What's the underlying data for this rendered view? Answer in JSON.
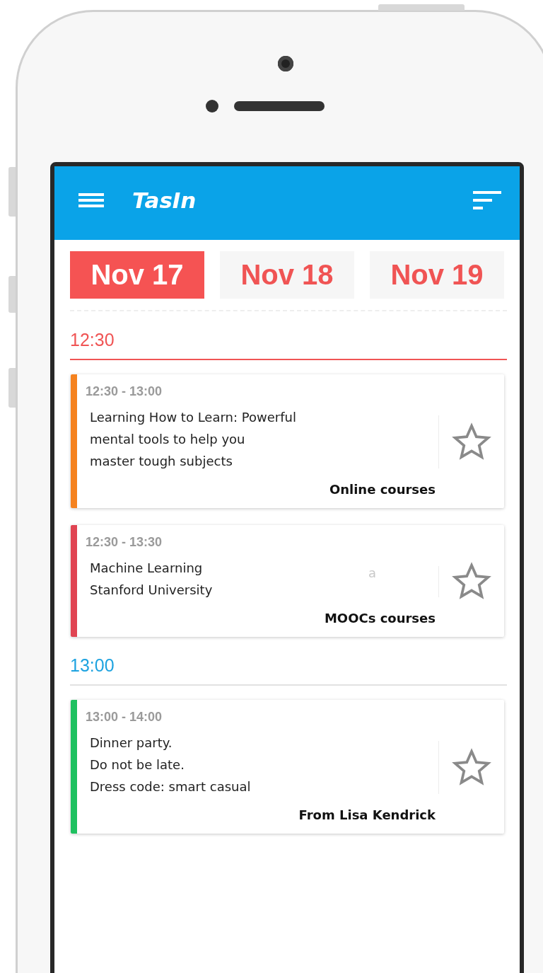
{
  "app_bar": {
    "title": "TasIn"
  },
  "date_tabs": [
    {
      "label": "Nov 17",
      "selected": true
    },
    {
      "label": "Nov 18",
      "selected": false
    },
    {
      "label": "Nov 19",
      "selected": false
    }
  ],
  "time_groups": [
    {
      "label": "12:30",
      "color": "#f05454",
      "current": true,
      "events": [
        {
          "time": "12:30 - 13:00",
          "lines": [
            "Learning How to Learn: Powerful",
            "mental tools to help you",
            "master tough  subjects"
          ],
          "tag": "Online courses",
          "color": "#f5821f",
          "starred": false
        },
        {
          "time": "12:30 - 13:30",
          "lines": [
            "Machine Learning",
            "Stanford University"
          ],
          "stray_mark": "a",
          "tag": "MOOCs courses",
          "color": "#e04452",
          "starred": false
        }
      ]
    },
    {
      "label": "13:00",
      "color": "#1ea3e0",
      "current": false,
      "events": [
        {
          "time": "13:00 - 14:00",
          "lines": [
            "Dinner party.",
            "Do not be late.",
            "Dress code: smart casual"
          ],
          "tag": "From Lisa Kendrick",
          "color": "#1fc160",
          "starred": false
        }
      ]
    }
  ]
}
